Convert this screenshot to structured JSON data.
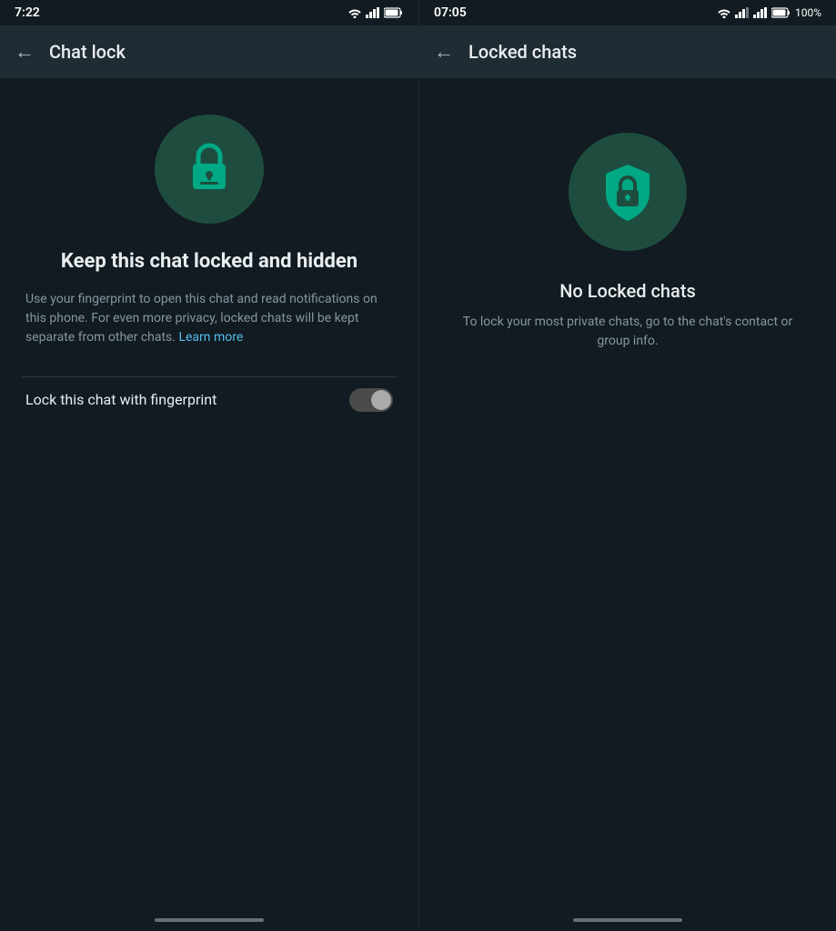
{
  "left": {
    "statusBar": {
      "time": "7:22",
      "icons": [
        "signal",
        "wifi",
        "battery"
      ]
    },
    "header": {
      "backLabel": "←",
      "title": "Chat lock"
    },
    "content": {
      "iconAlt": "lock-chat-icon",
      "heading": "Keep this chat locked and hidden",
      "description": "Use your fingerprint to open this chat and read notifications on this phone. For even more privacy, locked chats will be kept separate from other chats.",
      "learnMore": "Learn more",
      "toggleLabel": "Lock this chat with fingerprint",
      "toggleState": false
    },
    "homeIndicator": "home-indicator"
  },
  "right": {
    "statusBar": {
      "time": "07:05",
      "battery": "100%"
    },
    "header": {
      "backLabel": "←",
      "title": "Locked chats"
    },
    "content": {
      "iconAlt": "shield-lock-icon",
      "heading": "No Locked chats",
      "description": "To lock your most private chats, go to the chat's contact or group info."
    },
    "homeIndicator": "home-indicator"
  }
}
